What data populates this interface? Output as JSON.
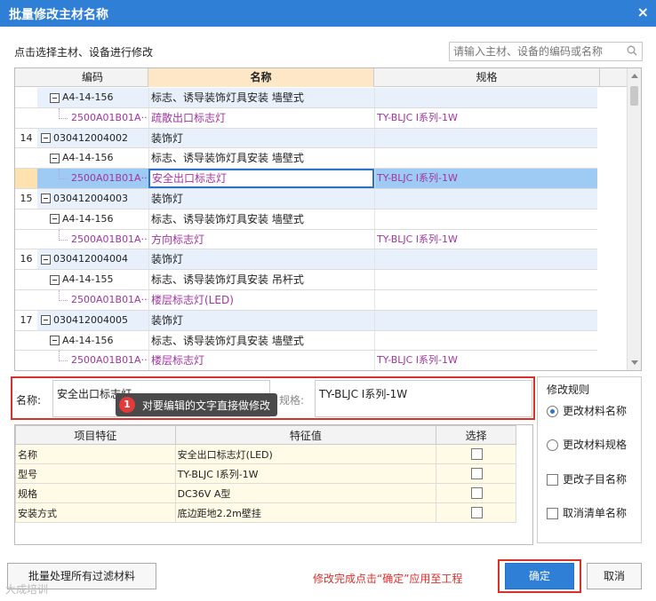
{
  "window": {
    "title": "批量修改主材名称",
    "close": "×"
  },
  "hint": "点击选择主材、设备进行修改",
  "search": {
    "placeholder": "请输入主材、设备的编码或名称"
  },
  "grid": {
    "headers": [
      "编码",
      "名称",
      "规格"
    ],
    "rows": [
      {
        "num": "",
        "code": "A4-14-156",
        "level": 1,
        "name": "标志、诱导装饰灯具安装 墙壁式",
        "spec": "",
        "style": "blue"
      },
      {
        "num": "",
        "code": "2500A01B01A···",
        "level": 2,
        "name": "疏散出口标志灯",
        "spec": "TY-BLJC I系列-1W",
        "style": ""
      },
      {
        "num": "14",
        "code": "030412004002",
        "level": 0,
        "name": "装饰灯",
        "spec": "",
        "style": "blue"
      },
      {
        "num": "",
        "code": "A4-14-156",
        "level": 1,
        "name": "标志、诱导装饰灯具安装 墙壁式",
        "spec": "",
        "style": ""
      },
      {
        "num": "",
        "code": "2500A01B01A···",
        "level": 2,
        "name": "安全出口标志灯",
        "spec": "TY-BLJC I系列-1W",
        "style": "sel"
      },
      {
        "num": "15",
        "code": "030412004003",
        "level": 0,
        "name": "装饰灯",
        "spec": "",
        "style": "blue"
      },
      {
        "num": "",
        "code": "A4-14-156",
        "level": 1,
        "name": "标志、诱导装饰灯具安装 墙壁式",
        "spec": "",
        "style": ""
      },
      {
        "num": "",
        "code": "2500A01B01A···",
        "level": 2,
        "name": "方向标志灯",
        "spec": "TY-BLJC I系列-1W",
        "style": ""
      },
      {
        "num": "16",
        "code": "030412004004",
        "level": 0,
        "name": "装饰灯",
        "spec": "",
        "style": "blue"
      },
      {
        "num": "",
        "code": "A4-14-155",
        "level": 1,
        "name": "标志、诱导装饰灯具安装 吊杆式",
        "spec": "",
        "style": ""
      },
      {
        "num": "",
        "code": "2500A01B01A···",
        "level": 2,
        "name": "楼层标志灯(LED)",
        "spec": "",
        "style": ""
      },
      {
        "num": "17",
        "code": "030412004005",
        "level": 0,
        "name": "装饰灯",
        "spec": "",
        "style": "blue"
      },
      {
        "num": "",
        "code": "A4-14-156",
        "level": 1,
        "name": "标志、诱导装饰灯具安装 墙壁式",
        "spec": "",
        "style": ""
      },
      {
        "num": "",
        "code": "2500A01B01A···",
        "level": 2,
        "name": "楼层标志灯",
        "spec": "TY-BLJC I系列-1W",
        "style": ""
      }
    ]
  },
  "edit": {
    "name_label": "名称:",
    "name_value": "安全出口标志灯",
    "spec_label": "规格:",
    "spec_value": "TY-BLJC I系列-1W",
    "tip_badge": "1",
    "tip_text": "对要编辑的文字直接做修改"
  },
  "features": {
    "headers": [
      "项目特征",
      "特征值",
      "选择"
    ],
    "rows": [
      {
        "name": "名称",
        "value": "安全出口标志灯(LED)"
      },
      {
        "name": "型号",
        "value": "TY-BLJC I系列-1W"
      },
      {
        "name": "规格",
        "value": "DC36V A型"
      },
      {
        "name": "安装方式",
        "value": "底边距地2.2m壁挂"
      }
    ]
  },
  "rules": {
    "title": "修改规则",
    "radio1": "更改材料名称",
    "radio2": "更改材料规格",
    "check1": "更改子目名称",
    "check2": "取消清单名称"
  },
  "footer": {
    "batch_label": "批量处理所有过滤材料",
    "note": "修改完成点击“确定”应用至工程",
    "ok_label": "确定",
    "cancel_label": "取消",
    "watermark": "大成培训"
  },
  "colors": {
    "title_bar": "#2f7fd6",
    "highlight_red": "#d9302c",
    "material_purple": "#a035a0",
    "selected_row": "#9ecbf3"
  }
}
